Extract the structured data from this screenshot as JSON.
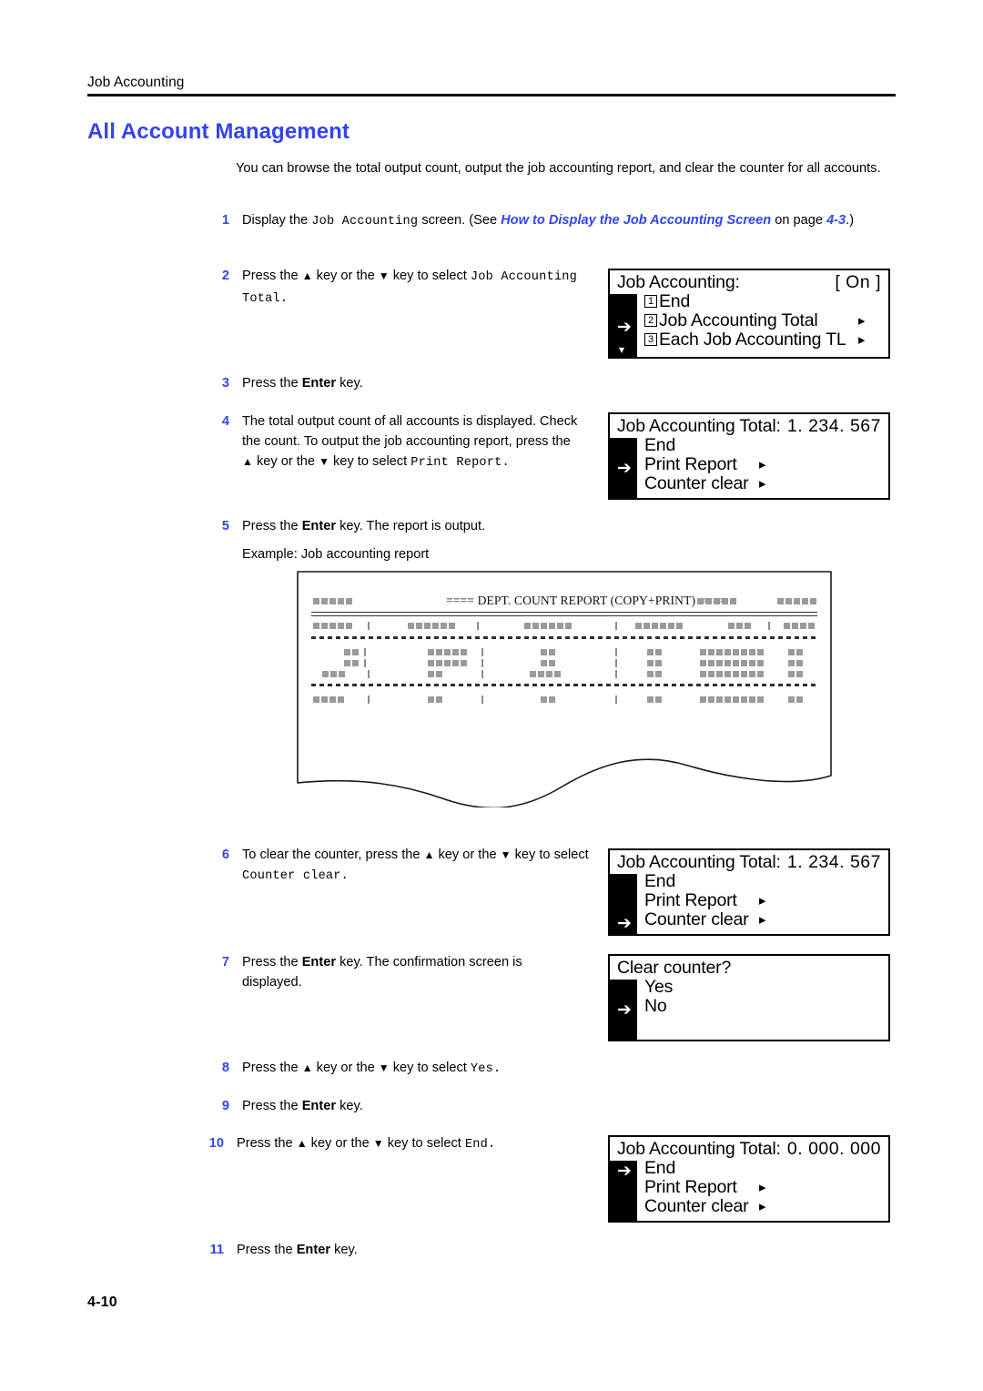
{
  "header": {
    "running_head": "Job Accounting",
    "section_title": "All Account Management"
  },
  "intro": "You can browse the total output count, output the job accounting report, and clear the counter for all accounts.",
  "steps": [
    {
      "num": "1",
      "text_1": "Display the ",
      "mono_1": "Job Accounting",
      "text_2": " screen. (See ",
      "link_1": "How to Display the Job Accounting Screen",
      "text_3": " on page ",
      "link_2": "4-3",
      "text_4": ".)"
    },
    {
      "num": "2",
      "text_1": "Press the ",
      "up": "▲",
      "text_2": " key or the ",
      "down": "▼",
      "text_3": " key to select ",
      "mono_1": "Job Accounting Total",
      "mono_2": "."
    },
    {
      "num": "3",
      "text_1": "Press the ",
      "bold_1": "Enter",
      "text_2": " key."
    },
    {
      "num": "4",
      "text_1": "The total output count of all accounts is displayed. Check the count. To output the job accounting report, press the ",
      "up": "▲",
      "text_2": " key or the ",
      "down": "▼",
      "text_3": " key to select ",
      "mono_1": "Print Report",
      "mono_2": "."
    },
    {
      "num": "5",
      "text_1": "Press the ",
      "bold_1": "Enter",
      "text_2": " key. The report is output.",
      "caption": "Example: Job accounting report"
    },
    {
      "num": "6",
      "text_1": "To clear the counter, press the ",
      "up": "▲",
      "text_2": " key or the ",
      "down": "▼",
      "text_3": " key to select ",
      "mono_1": "Counter clear",
      "mono_2": "."
    },
    {
      "num": "7",
      "text_1": "Press the ",
      "bold_1": "Enter",
      "text_2": " key. The confirmation screen is displayed."
    },
    {
      "num": "8",
      "text_1": "Press the ",
      "up": "▲",
      "text_2": " key or the ",
      "down": "▼",
      "text_3": " key to select ",
      "mono_1": "Yes",
      "mono_2": "."
    },
    {
      "num": "9",
      "text_1": "Press the ",
      "bold_1": "Enter",
      "text_2": " key."
    },
    {
      "num": "10",
      "text_1": "Press the ",
      "up": "▲",
      "text_2": " key or the ",
      "down": "▼",
      "text_3": " key to select ",
      "mono_1": "End",
      "mono_2": "."
    },
    {
      "num": "11",
      "text_1": "Press the ",
      "bold_1": "Enter",
      "text_2": " key."
    }
  ],
  "lcd_screens": [
    {
      "id": "job-accounting-menu",
      "title": "Job Accounting:",
      "value": "[ On ]",
      "cursor_row": 1,
      "scroll_down": true,
      "rows": [
        {
          "keynum": "1",
          "label": "End",
          "submark": ""
        },
        {
          "keynum": "2",
          "label": "Job Accounting Total",
          "submark": "▸"
        },
        {
          "keynum": "3",
          "label": "Each Job Accounting TL",
          "submark": "▸"
        }
      ]
    },
    {
      "id": "job-accounting-total-before",
      "title": "Job Accounting Total:",
      "value": "1. 234. 567",
      "cursor_row": 1,
      "scroll_down": false,
      "rows": [
        {
          "keynum": "",
          "label": "End",
          "submark": ""
        },
        {
          "keynum": "",
          "label": "Print Report",
          "submark": "▸"
        },
        {
          "keynum": "",
          "label": "Counter clear",
          "submark": "▸"
        }
      ]
    },
    {
      "id": "job-accounting-total-counter-clear",
      "title": "Job Accounting Total:",
      "value": "1. 234. 567",
      "cursor_row": 2,
      "scroll_down": false,
      "rows": [
        {
          "keynum": "",
          "label": "End",
          "submark": ""
        },
        {
          "keynum": "",
          "label": "Print Report",
          "submark": "▸"
        },
        {
          "keynum": "",
          "label": "Counter clear",
          "submark": "▸"
        }
      ]
    },
    {
      "id": "clear-counter-confirm",
      "title": "Clear counter?",
      "value": "",
      "cursor_row": 1,
      "scroll_down": false,
      "rows": [
        {
          "keynum": "",
          "label": "Yes",
          "submark": ""
        },
        {
          "keynum": "",
          "label": "No",
          "submark": ""
        }
      ]
    },
    {
      "id": "job-accounting-total-after",
      "title": "Job Accounting Total:",
      "value": "0. 000. 000",
      "cursor_row": 0,
      "scroll_down": false,
      "rows": [
        {
          "keynum": "",
          "label": "End",
          "submark": ""
        },
        {
          "keynum": "",
          "label": "Print Report",
          "submark": "▸"
        },
        {
          "keynum": "",
          "label": "Counter clear",
          "submark": "▸"
        }
      ]
    }
  ],
  "report": {
    "title": "==== DEPT. COUNT REPORT (COPY+PRINT) ==== "
  },
  "footer": {
    "folio": "4-10"
  },
  "colors": {
    "accent_blue": "#3344ee",
    "text_black": "#000000",
    "report_grey": "#9a9a9a"
  }
}
